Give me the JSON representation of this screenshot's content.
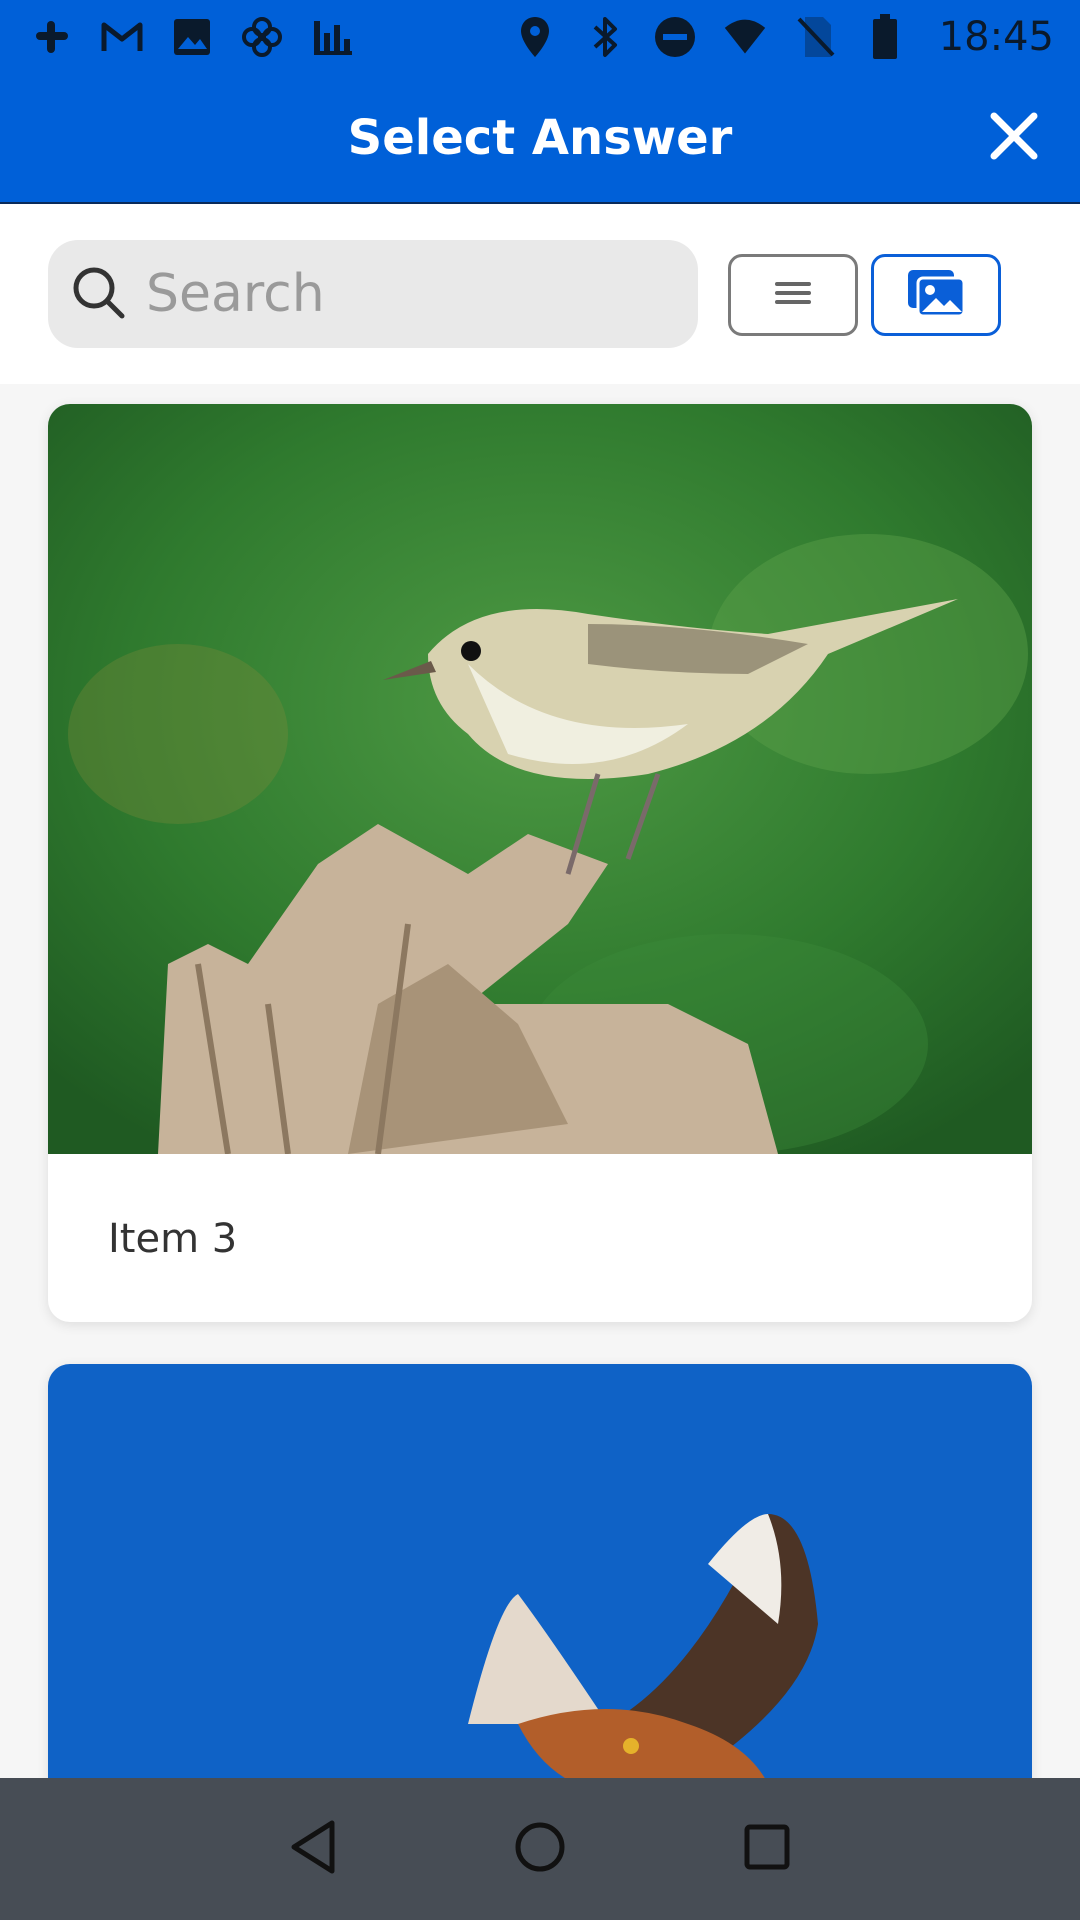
{
  "status_bar": {
    "time": "18:45",
    "left_icons": [
      "slack-icon",
      "gmail-icon",
      "gallery-icon",
      "pinwheel-icon",
      "stats-icon"
    ],
    "right_icons": [
      "location-icon",
      "bluetooth-icon",
      "do-not-disturb-icon",
      "wifi-icon",
      "no-sim-icon",
      "battery-icon"
    ]
  },
  "app_bar": {
    "title": "Select Answer",
    "close_icon": "close-icon"
  },
  "toolbar": {
    "search_placeholder": "Search",
    "list_view_icon": "list-icon",
    "gallery_view_icon": "image-icon",
    "selected_view": "gallery"
  },
  "items": [
    {
      "label": "Item 3",
      "image": "warbler-on-branch"
    },
    {
      "label": "",
      "image": "red-kite-in-flight"
    }
  ],
  "nav_bar": {
    "buttons": [
      "back-icon",
      "home-icon",
      "recents-icon"
    ]
  },
  "colors": {
    "primary": "#0060d8",
    "nav_bar": "#474d55",
    "search_bg": "#e9e9e9"
  }
}
